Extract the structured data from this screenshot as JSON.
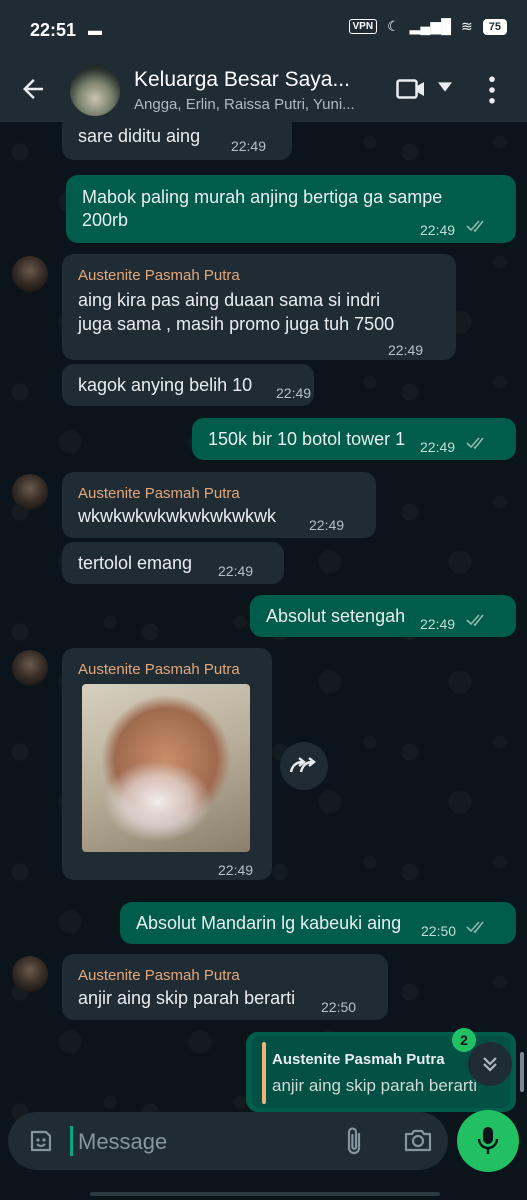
{
  "status_bar": {
    "time": "22:51",
    "vpn": "VPN",
    "battery": "75"
  },
  "header": {
    "title": "Keluarga Besar Saya...",
    "subtitle": "Angga, Erlin, Raissa Putri, Yuni..."
  },
  "messages": [
    {
      "text": "sare diditu aing",
      "time": "22:49"
    },
    {
      "text_line1": "Mabok paling murah anjing bertiga ga sampe",
      "text_line2": "200rb",
      "time": "22:49"
    },
    {
      "sender": "Austenite Pasmah Putra",
      "text_line1": "aing kira pas aing duaan sama si indri",
      "text_line2": "juga sama , masih promo juga tuh 7500",
      "time": "22:49"
    },
    {
      "text": "kagok anying belih 10",
      "time": "22:49"
    },
    {
      "text": "150k bir 10 botol tower 1",
      "time": "22:49"
    },
    {
      "sender": "Austenite Pasmah Putra",
      "text": "wkwkwkwkwkwkwkwkwk",
      "time": "22:49"
    },
    {
      "text": "tertolol emang",
      "time": "22:49"
    },
    {
      "text": "Absolut setengah",
      "time": "22:49"
    },
    {
      "sender": "Austenite Pasmah Putra",
      "time": "22:49"
    },
    {
      "text": "Absolut Mandarin lg kabeuki aing",
      "time": "22:50"
    },
    {
      "sender": "Austenite Pasmah Putra",
      "text": "anjir aing skip parah berarti",
      "time": "22:50"
    },
    {
      "quote_sender": "Austenite Pasmah Putra",
      "quote_text": "anjir aing skip parah berarti"
    }
  ],
  "unread_count": "2",
  "composer": {
    "placeholder": "Message"
  },
  "colors": {
    "incoming": "#1f2c34",
    "outgoing": "#005c4b",
    "sender_name": "#e4a77b",
    "accent": "#21c063"
  }
}
